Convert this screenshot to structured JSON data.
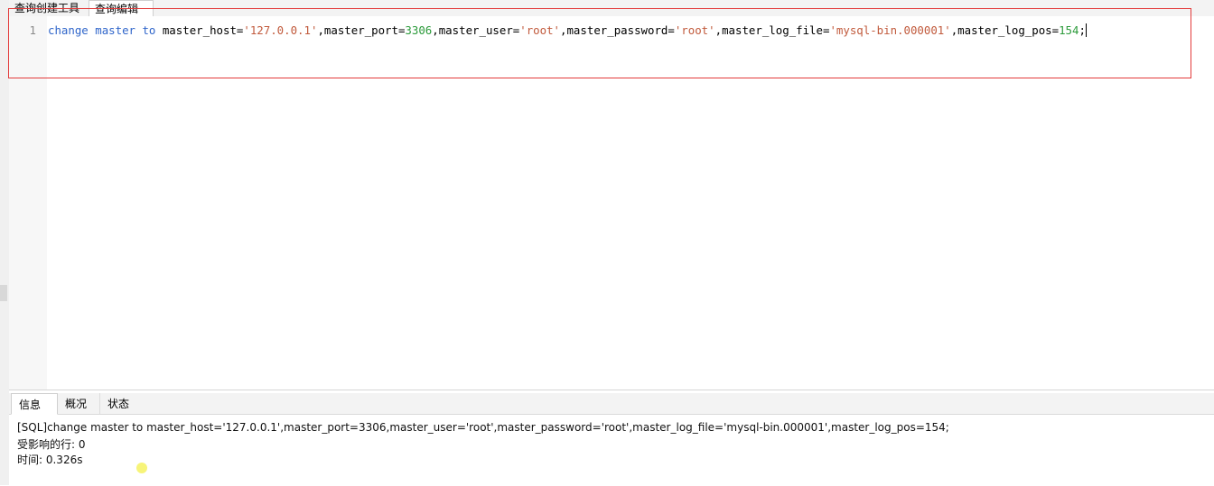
{
  "tabs": {
    "query_builder": "查询创建工具",
    "query_editor": "查询编辑器"
  },
  "editor": {
    "line_number": "1",
    "code": {
      "kw_change": "change",
      "kw_master": "master",
      "kw_to": "to",
      "p1": " master_host=",
      "host": "'127.0.0.1'",
      "p2": ",master_port=",
      "port": "3306",
      "p3": ",master_user=",
      "user": "'root'",
      "p4": ",master_password=",
      "password": "'root'",
      "p5": ",master_log_file=",
      "log_file": "'mysql-bin.000001'",
      "p6": ",master_log_pos=",
      "log_pos": "154",
      "end": ";"
    }
  },
  "result_tabs": {
    "info": "信息",
    "overview": "概况",
    "status": "状态"
  },
  "messages": {
    "sql": "[SQL]change master to master_host='127.0.0.1',master_port=3306,master_user='root',master_password='root',master_log_file='mysql-bin.000001',master_log_pos=154;",
    "affected_rows": "受影响的行: 0",
    "time": "时间: 0.326s"
  },
  "colors": {
    "keyword": "#2f65ca",
    "string": "#c15a3c",
    "number": "#2b9a3a",
    "highlight_border": "#e33b3b"
  }
}
